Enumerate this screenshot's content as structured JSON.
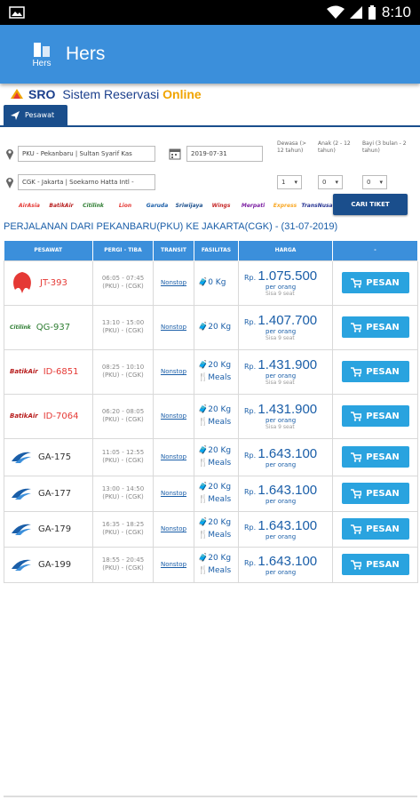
{
  "status": {
    "time": "8:10"
  },
  "app": {
    "title": "Hers",
    "logo_text": "Hers"
  },
  "brand": {
    "sro": "SRO",
    "name": "Sistem Reservasi",
    "online": "Online"
  },
  "tab": {
    "label": "Pesawat"
  },
  "form": {
    "origin": "PKU - Pekanbaru | Sultan Syarif Kas",
    "destination": "CGK - Jakarta | Soekarno Hatta Intl -",
    "date": "2019-07-31",
    "dewasa_label": "Dewasa (> 12 tahun)",
    "anak_label": "Anak (2 - 12 tahun)",
    "bayi_label": "Bayi (3 bulan - 2 tahun)",
    "dewasa": "1",
    "anak": "0",
    "bayi": "0",
    "cari": "CARI TIKET"
  },
  "airline_logos": [
    "AirAsia",
    "BatikAir",
    "Citilink",
    "Lion",
    "Garuda",
    "Sriwijaya",
    "Wings",
    "Merpati",
    "Express",
    "TransNusa"
  ],
  "route_title": "PERJALANAN DARI PEKANBARU(PKU) KE JAKARTA(CGK) - (31-07-2019)",
  "table": {
    "headers": [
      "PESAWAT",
      "PERGI - TIBA",
      "TRANSIT",
      "FASILITAS",
      "HARGA",
      "-"
    ],
    "rows": [
      {
        "code": "JT-393",
        "code_color": "#e53935",
        "times": "06:05 - 07:45",
        "route": "(PKU) - (CGK)",
        "transit": "Nonstop",
        "bag": "0 Kg",
        "meals": "",
        "rp": "Rp.",
        "price": "1.075.500",
        "per": "per orang",
        "seat": "Sisa 9 seat",
        "btn": "PESAN"
      },
      {
        "code": "QG-937",
        "code_color": "#2e7d32",
        "times": "13:10 - 15:00",
        "route": "(PKU) - (CGK)",
        "transit": "Nonstop",
        "bag": "20 Kg",
        "meals": "",
        "rp": "Rp.",
        "price": "1.407.700",
        "per": "per orang",
        "seat": "Sisa 9 seat",
        "btn": "PESAN"
      },
      {
        "code": "ID-6851",
        "code_color": "#e53935",
        "times": "08:25 - 10:10",
        "route": "(PKU) - (CGK)",
        "transit": "Nonstop",
        "bag": "20 Kg",
        "meals": "Meals",
        "rp": "Rp.",
        "price": "1.431.900",
        "per": "per orang",
        "seat": "Sisa 9 seat",
        "btn": "PESAN"
      },
      {
        "code": "ID-7064",
        "code_color": "#e53935",
        "times": "06:20 - 08:05",
        "route": "(PKU) - (CGK)",
        "transit": "Nonstop",
        "bag": "20 Kg",
        "meals": "Meals",
        "rp": "Rp.",
        "price": "1.431.900",
        "per": "per orang",
        "seat": "Sisa 9 seat",
        "btn": "PESAN"
      },
      {
        "code": "GA-175",
        "code_color": "#333333",
        "times": "11:05 - 12:55",
        "route": "(PKU) - (CGK)",
        "transit": "Nonstop",
        "bag": "20 Kg",
        "meals": "Meals",
        "rp": "Rp.",
        "price": "1.643.100",
        "per": "per orang",
        "seat": "",
        "btn": "PESAN"
      },
      {
        "code": "GA-177",
        "code_color": "#333333",
        "times": "13:00 - 14:50",
        "route": "(PKU) - (CGK)",
        "transit": "Nonstop",
        "bag": "20 Kg",
        "meals": "Meals",
        "rp": "Rp.",
        "price": "1.643.100",
        "per": "per orang",
        "seat": "",
        "btn": "PESAN"
      },
      {
        "code": "GA-179",
        "code_color": "#333333",
        "times": "16:35 - 18:25",
        "route": "(PKU) - (CGK)",
        "transit": "Nonstop",
        "bag": "20 Kg",
        "meals": "Meals",
        "rp": "Rp.",
        "price": "1.643.100",
        "per": "per orang",
        "seat": "",
        "btn": "PESAN"
      },
      {
        "code": "GA-199",
        "code_color": "#333333",
        "times": "18:55 - 20:45",
        "route": "(PKU) - (CGK)",
        "transit": "Nonstop",
        "bag": "20 Kg",
        "meals": "Meals",
        "rp": "Rp.",
        "price": "1.643.100",
        "per": "per orang",
        "seat": "",
        "btn": "PESAN"
      }
    ]
  }
}
